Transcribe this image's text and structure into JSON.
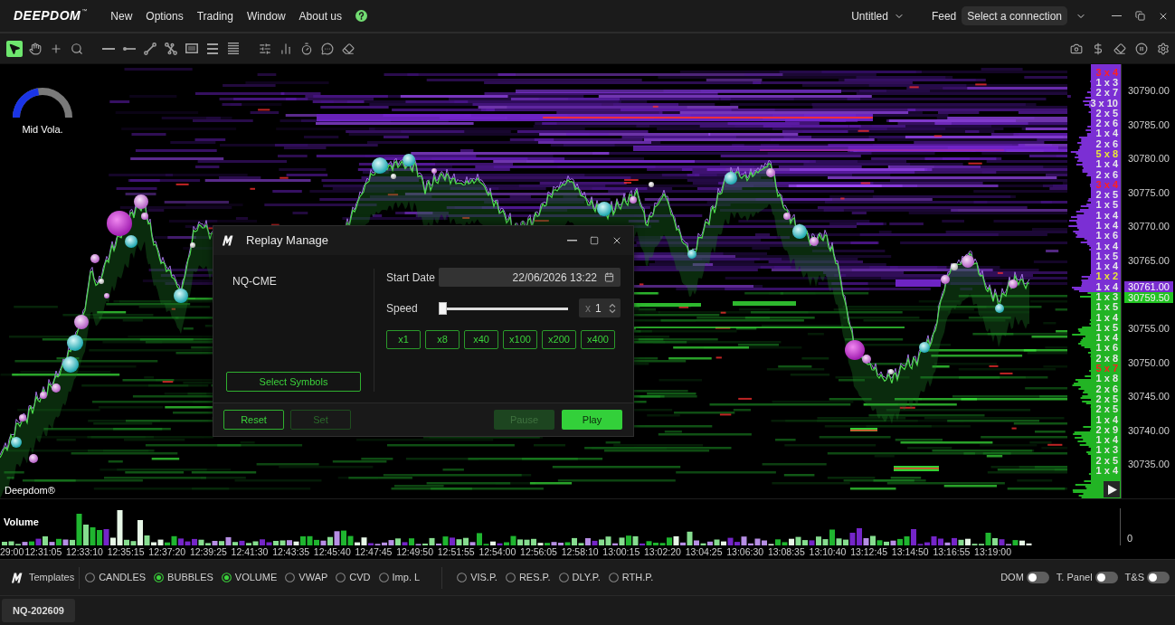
{
  "menu_bar": {
    "logo": "DEEPDOM",
    "logo_mark": "™",
    "menu": [
      "New",
      "Options",
      "Trading",
      "Window",
      "About us"
    ],
    "workspace": "Untitled",
    "feed_label": "Feed",
    "connection": "Select a connection"
  },
  "toolbar": {
    "groups": [
      {
        "tools": [
          {
            "kind": "pointer",
            "selected": true
          },
          {
            "kind": "hand",
            "selected": false
          },
          {
            "kind": "crosshair",
            "selected": false
          },
          {
            "kind": "zoom",
            "selected": false
          }
        ]
      },
      {
        "tools": [
          {
            "kind": "hline",
            "selected": false
          },
          {
            "kind": "ray",
            "selected": false
          },
          {
            "kind": "trendline",
            "selected": false
          },
          {
            "kind": "path",
            "selected": false
          },
          {
            "kind": "rectangle",
            "selected": false
          },
          {
            "kind": "lines3",
            "selected": false
          },
          {
            "kind": "lines5",
            "selected": false
          }
        ]
      },
      {
        "tools": [
          {
            "kind": "sliders",
            "selected": false
          },
          {
            "kind": "bars",
            "selected": false
          },
          {
            "kind": "timer",
            "selected": false
          },
          {
            "kind": "comment",
            "selected": false
          },
          {
            "kind": "eraser",
            "selected": false
          }
        ]
      }
    ],
    "actions": [
      {
        "kind": "camera"
      },
      {
        "kind": "dollar"
      },
      {
        "kind": "eraser"
      },
      {
        "kind": "pause"
      },
      {
        "kind": "gear"
      }
    ]
  },
  "chart": {
    "gauge": {
      "label": "Mid Vola.",
      "level": 0.45
    },
    "brand_label": "Deepdom®",
    "dom_ladder": {
      "asks": [
        {
          "text": "3 x 4",
          "color": "#ff2020"
        },
        {
          "text": "1 x 3",
          "color": "#e8e8e8"
        },
        {
          "text": "2 x 7",
          "color": "#e8e8e8"
        },
        {
          "text": "3 x 10",
          "color": "#e8e8e8"
        },
        {
          "text": "2 x 5",
          "color": "#e8e8e8"
        },
        {
          "text": "2 x 6",
          "color": "#e8e8e8"
        },
        {
          "text": "1 x 4",
          "color": "#e8e8e8"
        },
        {
          "text": "2 x 6",
          "color": "#e8e8e8"
        },
        {
          "text": "5 x 8",
          "color": "#e8e83a"
        },
        {
          "text": "1 x 4",
          "color": "#e8e8e8"
        },
        {
          "text": "2 x 6",
          "color": "#e8e8e8"
        },
        {
          "text": "3 x 4",
          "color": "#ff2020"
        },
        {
          "text": "2 x 5",
          "color": "#e8e8e8"
        },
        {
          "text": "1 x 5",
          "color": "#e8e8e8"
        },
        {
          "text": "1 x 4",
          "color": "#e8e8e8"
        },
        {
          "text": "1 x 4",
          "color": "#e8e8e8"
        },
        {
          "text": "1 x 6",
          "color": "#e8e8e8"
        },
        {
          "text": "1 x 4",
          "color": "#e8e8e8"
        },
        {
          "text": "1 x 5",
          "color": "#e8e8e8"
        },
        {
          "text": "1 x 4",
          "color": "#e8e8e8"
        },
        {
          "text": "1 x 2",
          "color": "#e8e83a"
        },
        {
          "text": "1 x 4",
          "color": "#e8e8e8"
        }
      ],
      "bids": [
        {
          "text": "1 x 3",
          "color": "#e8e8e8"
        },
        {
          "text": "1 x 5",
          "color": "#e8e8e8"
        },
        {
          "text": "1 x 4",
          "color": "#e8e8e8"
        },
        {
          "text": "1 x 5",
          "color": "#e8e8e8"
        },
        {
          "text": "1 x 4",
          "color": "#e8e8e8"
        },
        {
          "text": "1 x 6",
          "color": "#e8e8e8"
        },
        {
          "text": "2 x 8",
          "color": "#e8e8e8"
        },
        {
          "text": "5 x 7",
          "color": "#ff2020"
        },
        {
          "text": "1 x 8",
          "color": "#e8e8e8"
        },
        {
          "text": "2 x 6",
          "color": "#e8e8e8"
        },
        {
          "text": "2 x 5",
          "color": "#e8e8e8"
        },
        {
          "text": "2 x 5",
          "color": "#e8e8e8"
        },
        {
          "text": "1 x 4",
          "color": "#e8e8e8"
        },
        {
          "text": "2 x 9",
          "color": "#e8e8e8"
        },
        {
          "text": "1 x 4",
          "color": "#e8e8e8"
        },
        {
          "text": "1 x 3",
          "color": "#e8e8e8"
        },
        {
          "text": "2 x 5",
          "color": "#e8e8e8"
        },
        {
          "text": "1 x 4",
          "color": "#e8e8e8"
        }
      ]
    },
    "price_axis": {
      "upper_ticks": [
        "30790.00",
        "30785.00",
        "30780.00",
        "30775.00",
        "30770.00",
        "30765.00"
      ],
      "ask_price": "30761.00",
      "bid_price": "30759.50",
      "lower_ticks": [
        "30755.00",
        "30750.00",
        "30745.00",
        "30740.00",
        "30735.00"
      ]
    }
  },
  "replay_dialog": {
    "title": "Replay Manage",
    "symbols": [
      "NQ-CME"
    ],
    "select_button": "Select Symbols",
    "start_date_label": "Start Date",
    "start_date": "22/06/2026 13:22",
    "speed_label": "Speed",
    "speed": {
      "level": 0,
      "prefix": "x",
      "value": "1"
    },
    "speed_presets": [
      "x1",
      "x8",
      "x40",
      "x100",
      "x200",
      "x400"
    ],
    "buttons": [
      {
        "label": "Reset",
        "kind": "outline",
        "disabled": false
      },
      {
        "label": "Set",
        "kind": "outline",
        "disabled": true
      },
      {
        "label": "Pause",
        "kind": "filled",
        "disabled": true
      },
      {
        "label": "Play",
        "kind": "filled",
        "disabled": false
      }
    ]
  },
  "volume_panel": {
    "title": "Volume",
    "axis_label": "0"
  },
  "time_axis": [
    "29:00",
    "12:31:05",
    "12:33:10",
    "12:35:15",
    "12:37:20",
    "12:39:25",
    "12:41:30",
    "12:43:35",
    "12:45:40",
    "12:47:45",
    "12:49:50",
    "12:51:55",
    "12:54:00",
    "12:56:05",
    "12:58:10",
    "13:00:15",
    "13:02:20",
    "13:04:25",
    "13:06:30",
    "13:08:35",
    "13:10:40",
    "13:12:45",
    "13:14:50",
    "13:16:55",
    "13:19:00"
  ],
  "bottom_bar": {
    "templates_label": "Templates",
    "indicators": [
      {
        "label": "CANDLES",
        "checked": false
      },
      {
        "label": "BUBBLES",
        "checked": true
      },
      {
        "label": "VOLUME",
        "checked": true
      },
      {
        "label": "VWAP",
        "checked": false
      },
      {
        "label": "CVD",
        "checked": false
      },
      {
        "label": "Imp. L",
        "checked": false
      }
    ],
    "profiles": [
      {
        "label": "VIS.P.",
        "checked": false
      },
      {
        "label": "RES.P.",
        "checked": false
      },
      {
        "label": "DLY.P.",
        "checked": false
      },
      {
        "label": "RTH.P.",
        "checked": false
      }
    ],
    "toggles": [
      {
        "label": "DOM",
        "on": false
      },
      {
        "label": "T. Panel",
        "on": false
      },
      {
        "label": "T&S",
        "on": false
      }
    ]
  },
  "symbol_tabs": [
    {
      "label": "NQ-202609",
      "selected": true
    }
  ]
}
